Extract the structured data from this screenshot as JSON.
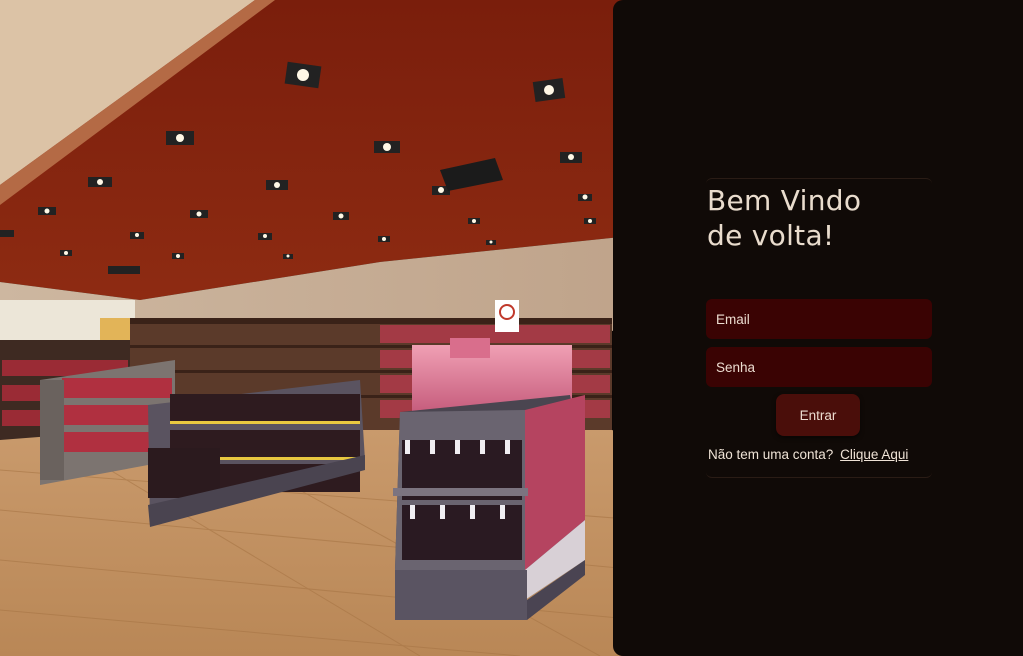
{
  "login": {
    "title": "Bem Vindo\nde volta!",
    "email_placeholder": "Email",
    "password_placeholder": "Senha",
    "submit_label": "Entrar",
    "no_account_text": "Não tem uma conta?",
    "signup_link": "Clique Aqui"
  },
  "colors": {
    "panel_background": "#100a07",
    "field_background": "#3a0303",
    "button_background": "#4a0e0a",
    "text": "#ecdcd0"
  }
}
